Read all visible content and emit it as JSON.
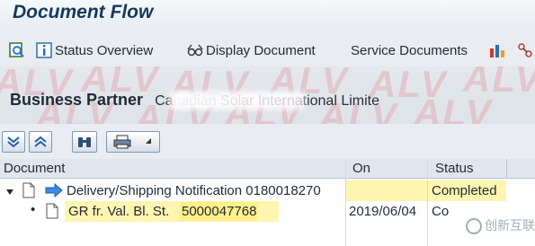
{
  "window": {
    "title": "Document Flow"
  },
  "toolbar": {
    "status_overview": "Status Overview",
    "display_document": "Display Document",
    "service_documents": "Service Documents"
  },
  "watermark": "ALV",
  "partner": {
    "label": "Business Partner",
    "value": "Canadian Solar International Limite"
  },
  "grid": {
    "columns": [
      "Document",
      "On",
      "Status"
    ],
    "rows": [
      {
        "document": "Delivery/Shipping Notification 0180018270",
        "on": "",
        "status": "Completed"
      },
      {
        "document_prefix": "GR fr. Val. Bl. St.",
        "document_number": "5000047768",
        "on": "2019/06/04",
        "status": "Co"
      }
    ]
  },
  "brand": {
    "text": "创新互联"
  },
  "colors": {
    "title": "#143a5a",
    "row_highlight": "#fff5b0",
    "selection_highlight": "#fff08a",
    "header_bg": "#dfe6ed"
  }
}
